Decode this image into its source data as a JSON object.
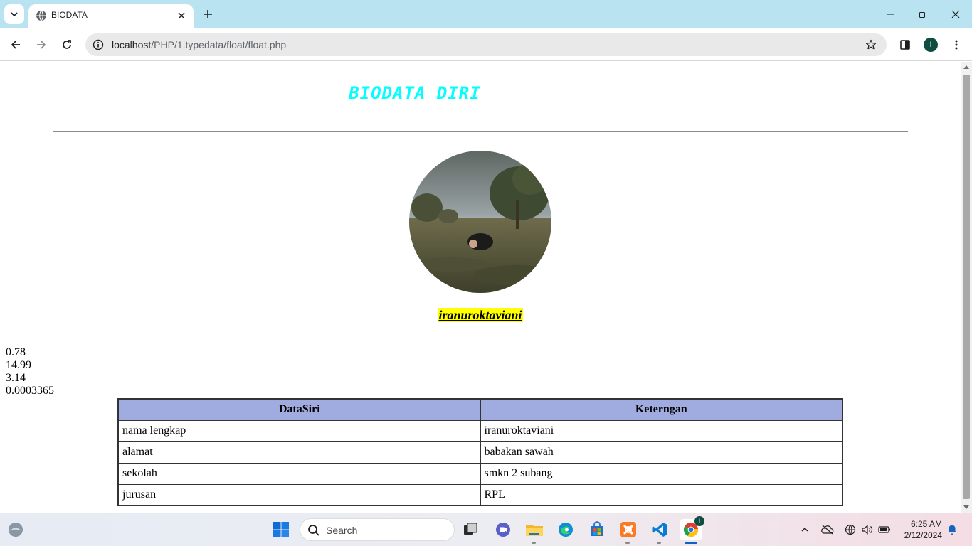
{
  "browser": {
    "tab_title": "BIODATA",
    "url_host": "localhost",
    "url_path": "/PHP/1.typedata/float/float.php",
    "profile_initial": "I"
  },
  "page": {
    "title": "BIODATA DIRI",
    "name": "iranuroktaviani",
    "floats": [
      "0.78",
      "14.99",
      "3.14",
      "0.0003365"
    ],
    "table": {
      "headers": [
        "DataSiri",
        "Keterngan"
      ],
      "rows": [
        [
          "nama lengkap",
          "iranuroktaviani"
        ],
        [
          "alamat",
          "babakan sawah"
        ],
        [
          "sekolah",
          "smkn 2 subang"
        ],
        [
          "jurusan",
          "RPL"
        ]
      ]
    },
    "colors": {
      "title": "#00ffff",
      "name_highlight": "#ffff00",
      "table_header_bg": "#a0acdf"
    }
  },
  "taskbar": {
    "search_placeholder": "Search",
    "time": "6:25 AM",
    "date": "2/12/2024",
    "chrome_badge": "I"
  }
}
